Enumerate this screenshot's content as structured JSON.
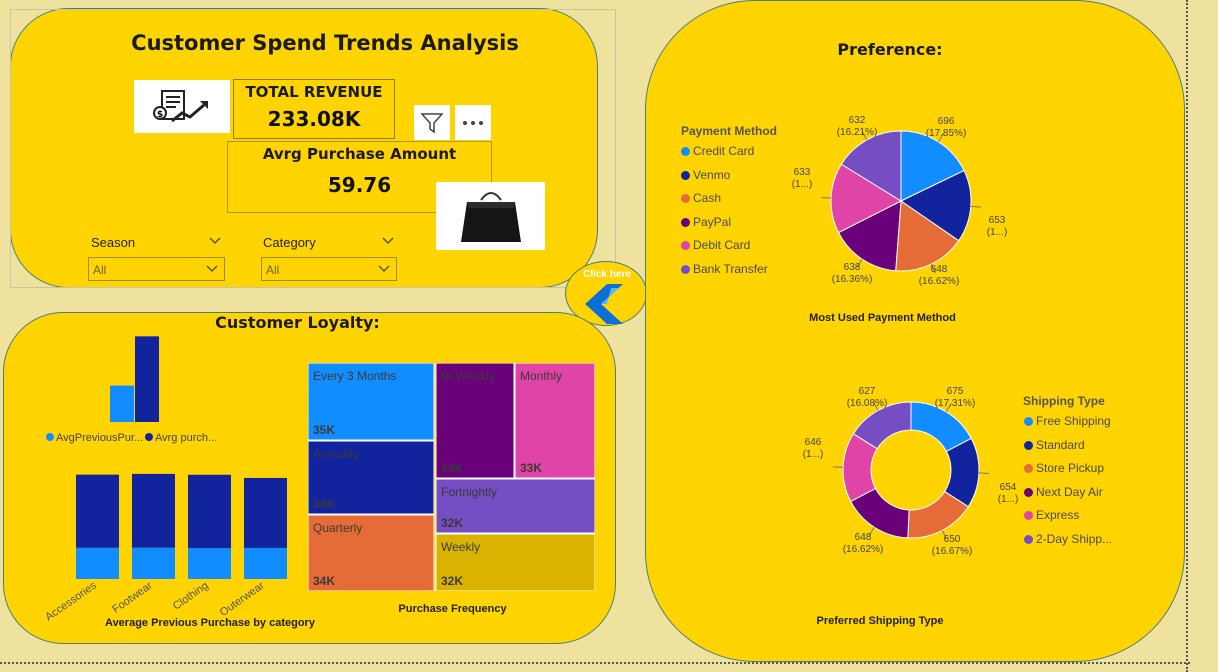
{
  "header": {
    "title": "Customer Spend Trends Analysis",
    "total_revenue_label": "TOTAL REVENUE",
    "total_revenue_value": "233.08K",
    "avg_purchase_label": "Avrg Purchase Amount",
    "avg_purchase_value": "59.76"
  },
  "filters": {
    "season_label": "Season",
    "season_value": "All",
    "category_label": "Category",
    "category_value": "All"
  },
  "nav_button_label": "Click here",
  "loyalty": {
    "title": "Customer Loyalty:"
  },
  "preference": {
    "title": "Preference:"
  },
  "colors": {
    "card": "#ffd400",
    "navy": "#12239e",
    "sky": "#118dff"
  },
  "chart_data": [
    {
      "type": "bar",
      "id": "avg-summary",
      "series": [
        {
          "name": "AvgPreviousPur...",
          "values": [
            25.4
          ]
        },
        {
          "name": "Avrg purch...",
          "values": [
            59.76
          ]
        }
      ],
      "legend": [
        "AvgPreviousPur...",
        "Avrg purch..."
      ],
      "series_colors": [
        "#118dff",
        "#12239e"
      ]
    },
    {
      "type": "bar",
      "stacked": true,
      "id": "avg-prev-by-category",
      "title": "Average Previous Purchase by category",
      "categories": [
        "Accessories",
        "Footwear",
        "Clothing",
        "Outerwear"
      ],
      "series": [
        {
          "values": [
            25.5,
            25.6,
            25.2,
            25.4
          ]
        },
        {
          "values": [
            59.8,
            60.3,
            60.0,
            57.2
          ]
        }
      ],
      "series_colors": [
        "#118dff",
        "#12239e"
      ],
      "ylim": [
        0,
        85
      ]
    },
    {
      "type": "treemap",
      "id": "purchase-frequency",
      "title": "Purchase Frequency",
      "items": [
        {
          "label": "Every 3 Months",
          "value_label": "35K",
          "color": "#118dff"
        },
        {
          "label": "Annually",
          "value_label": "34K",
          "color": "#12239e"
        },
        {
          "label": "Quarterly",
          "value_label": "34K",
          "color": "#e66c37"
        },
        {
          "label": "Bi-Weekly",
          "value_label": "33K",
          "color": "#6b007b"
        },
        {
          "label": "Monthly",
          "value_label": "33K",
          "color": "#e044a7"
        },
        {
          "label": "Fortnightly",
          "value_label": "32K",
          "color": "#744ec2"
        },
        {
          "label": "Weekly",
          "value_label": "32K",
          "color": "#d9b300"
        }
      ]
    },
    {
      "type": "pie",
      "id": "payment-method",
      "title": "Most Used Payment Method",
      "legend_title": "Payment Method",
      "slices": [
        {
          "label": "Credit Card",
          "value": 696,
          "pct": "(17.85%)",
          "color": "#118dff"
        },
        {
          "label": "Venmo",
          "value": 653,
          "pct": "(1...)",
          "color": "#12239e"
        },
        {
          "label": "Cash",
          "value": 648,
          "pct": "(16.62%)",
          "color": "#e66c37"
        },
        {
          "label": "PayPal",
          "value": 638,
          "pct": "(16.36%)",
          "color": "#6b007b"
        },
        {
          "label": "Debit Card",
          "value": 633,
          "pct": "(1...)",
          "color": "#e044a7"
        },
        {
          "label": "Bank Transfer",
          "value": 632,
          "pct": "(16.21%)",
          "color": "#744ec2"
        }
      ]
    },
    {
      "type": "pie",
      "donut": true,
      "id": "shipping-type",
      "title": "Preferred Shipping Type",
      "legend_title": "Shipping Type",
      "slices": [
        {
          "label": "Free Shipping",
          "value": 675,
          "pct": "(17.31%)",
          "color": "#118dff"
        },
        {
          "label": "Standard",
          "value": 654,
          "pct": "(1...)",
          "color": "#12239e"
        },
        {
          "label": "Store Pickup",
          "value": 650,
          "pct": "(16.67%)",
          "color": "#e66c37"
        },
        {
          "label": "Next Day Air",
          "value": 648,
          "pct": "(16.62%)",
          "color": "#6b007b"
        },
        {
          "label": "Express",
          "value": 646,
          "pct": "(1...)",
          "color": "#e044a7"
        },
        {
          "label": "2-Day Shipp...",
          "value": 627,
          "pct": "(16.08%)",
          "color": "#744ec2"
        }
      ]
    }
  ]
}
